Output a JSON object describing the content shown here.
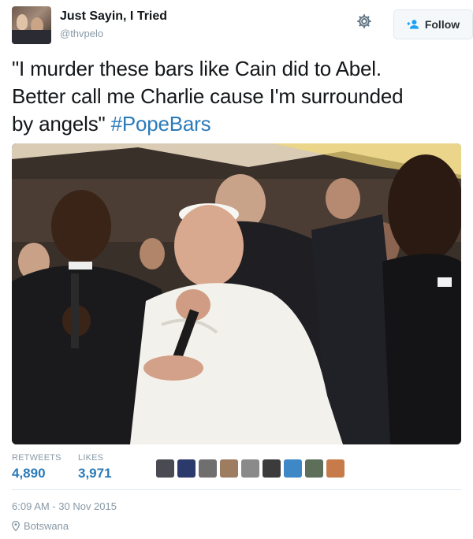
{
  "header": {
    "display_name": "Just Sayin, I Tried",
    "handle": "@thvpelo",
    "follow_label": "Follow"
  },
  "tweet": {
    "text_line1": "\"I murder these bars like Cain did to Abel.",
    "text_line2": "Better call me Charlie cause I'm surrounded",
    "text_line3_plain": "by angels\" ",
    "hashtag": "#PopeBars"
  },
  "stats": {
    "retweets_label": "RETWEETS",
    "retweets_value": "4,890",
    "likes_label": "LIKES",
    "likes_value": "3,971"
  },
  "likers": [
    {
      "icon": "liker-avatar",
      "color": "#4a4a52"
    },
    {
      "icon": "liker-avatar",
      "color": "#2c3a6b"
    },
    {
      "icon": "liker-avatar",
      "color": "#6f6f6f"
    },
    {
      "icon": "liker-avatar",
      "color": "#9e7c5f"
    },
    {
      "icon": "liker-avatar",
      "color": "#8a8a8a"
    },
    {
      "icon": "liker-avatar",
      "color": "#3b3b3b"
    },
    {
      "icon": "liker-avatar",
      "color": "#3f88c8"
    },
    {
      "icon": "liker-avatar",
      "color": "#5d6e59"
    },
    {
      "icon": "liker-avatar",
      "color": "#c77b4a"
    }
  ],
  "meta": {
    "timestamp": "6:09 AM - 30 Nov 2015",
    "location": "Botswana"
  },
  "colors": {
    "link_blue": "#2b7bb9",
    "muted_gray": "#8899a6",
    "divider": "#e1e8ed"
  }
}
